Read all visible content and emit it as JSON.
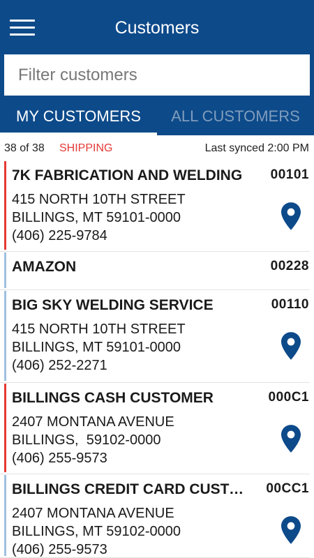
{
  "header": {
    "title": "Customers",
    "menu_icon": "hamburger-menu-icon",
    "background": "#0d4a8a"
  },
  "filter": {
    "placeholder": "Filter customers",
    "value": ""
  },
  "tabs": [
    {
      "label": "MY CUSTOMERS",
      "selected": true
    },
    {
      "label": "ALL CUSTOMERS",
      "selected": false
    }
  ],
  "status": {
    "count": "38 of 38",
    "filter_label": "SHIPPING",
    "filter_color": "#e53935",
    "last_synced": "Last synced 2:00 PM"
  },
  "customers": [
    {
      "name": "7K FABRICATION AND WELDING",
      "code": "00101",
      "address1": "415 NORTH 10TH STREET",
      "address2": "BILLINGS, MT 59101-0000",
      "phone": "(406) 225-9784",
      "bar_color": "#e53935",
      "has_location": true
    },
    {
      "name": "AMAZON",
      "code": "00228",
      "address1": "",
      "address2": "",
      "phone": "",
      "bar_color": "#9fc0e0",
      "has_location": false
    },
    {
      "name": "BIG SKY WELDING SERVICE",
      "code": "00110",
      "address1": "415 NORTH 10TH STREET",
      "address2": "BILLINGS, MT 59101-0000",
      "phone": "(406) 252-2271",
      "bar_color": "#9fc0e0",
      "has_location": true
    },
    {
      "name": "BILLINGS CASH CUSTOMER",
      "code": "000C1",
      "address1": "2407 MONTANA AVENUE",
      "address2": "BILLINGS,  59102-0000",
      "phone": "(406) 255-9573",
      "bar_color": "#e53935",
      "has_location": true
    },
    {
      "name": "BILLINGS CREDIT CARD CUSTOMER",
      "code": "00CC1",
      "address1": "2407 MONTANA AVENUE",
      "address2": "BILLINGS, MT 59102-0000",
      "phone": "(406) 255-9573",
      "bar_color": "#9fc0e0",
      "has_location": true
    }
  ],
  "icons": {
    "location": "map-pin-icon",
    "pin_color": "#0d4a8a"
  }
}
